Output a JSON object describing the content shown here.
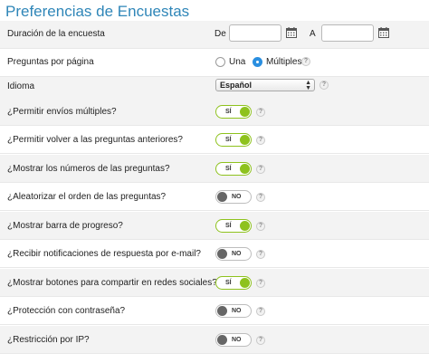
{
  "page_title": "Preferencias de Encuestas",
  "duration": {
    "label": "Duración de la encuesta",
    "from_label": "De",
    "to_label": "A",
    "from_value": "",
    "to_value": ""
  },
  "questions_per_page": {
    "label": "Preguntas por página",
    "options": [
      "Una",
      "Múltiples"
    ],
    "selected": "Múltiples"
  },
  "language": {
    "label": "Idioma",
    "selected": "Español"
  },
  "help_glyph": "?",
  "toggle_on_label": "SÍ",
  "toggle_off_label": "NO",
  "settings": [
    {
      "label": "¿Permitir envíos múltiples?",
      "value": "on"
    },
    {
      "label": "¿Permitir volver a las preguntas anteriores?",
      "value": "on"
    },
    {
      "label": "¿Mostrar los números de las preguntas?",
      "value": "on"
    },
    {
      "label": "¿Aleatorizar el orden de las preguntas?",
      "value": "off"
    },
    {
      "label": "¿Mostrar barra de progreso?",
      "value": "on"
    },
    {
      "label": "¿Recibir notificaciones de respuesta por e-mail?",
      "value": "off"
    },
    {
      "label": "¿Mostrar botones para compartir en redes sociales?",
      "value": "on"
    },
    {
      "label": "¿Protección con contraseña?",
      "value": "off"
    },
    {
      "label": "¿Restricción por IP?",
      "value": "off"
    }
  ],
  "colors": {
    "title": "#2f86b8",
    "toggle_on": "#8ec21d",
    "toggle_off_knob": "#666666",
    "radio_selected": "#2a8fe0"
  }
}
